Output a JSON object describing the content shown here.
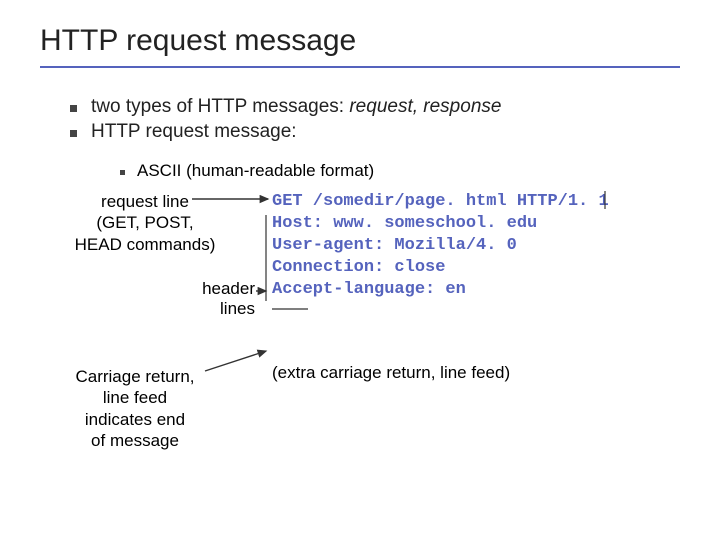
{
  "title": "HTTP request message",
  "bullets": {
    "b1_prefix": "two types of HTTP messages: ",
    "b1_italic": "request, response",
    "b2": "HTTP request message:"
  },
  "sub_bullet": "ASCII (human-readable format)",
  "labels": {
    "request_line_1": "request line",
    "request_line_2": "(GET, POST,",
    "request_line_3": "HEAD commands)",
    "header_1": "header",
    "header_2": "lines",
    "carriage_1": "Carriage return,",
    "carriage_2": "line feed",
    "carriage_3": "indicates end",
    "carriage_4": "of message"
  },
  "code": {
    "l1": "GET /somedir/page. html HTTP/1. 1",
    "l2": "Host: www. someschool. edu",
    "l3": "User-agent: Mozilla/4. 0",
    "l4": "Connection: close",
    "l5": "Accept-language: en"
  },
  "extra": "(extra carriage return, line feed)"
}
